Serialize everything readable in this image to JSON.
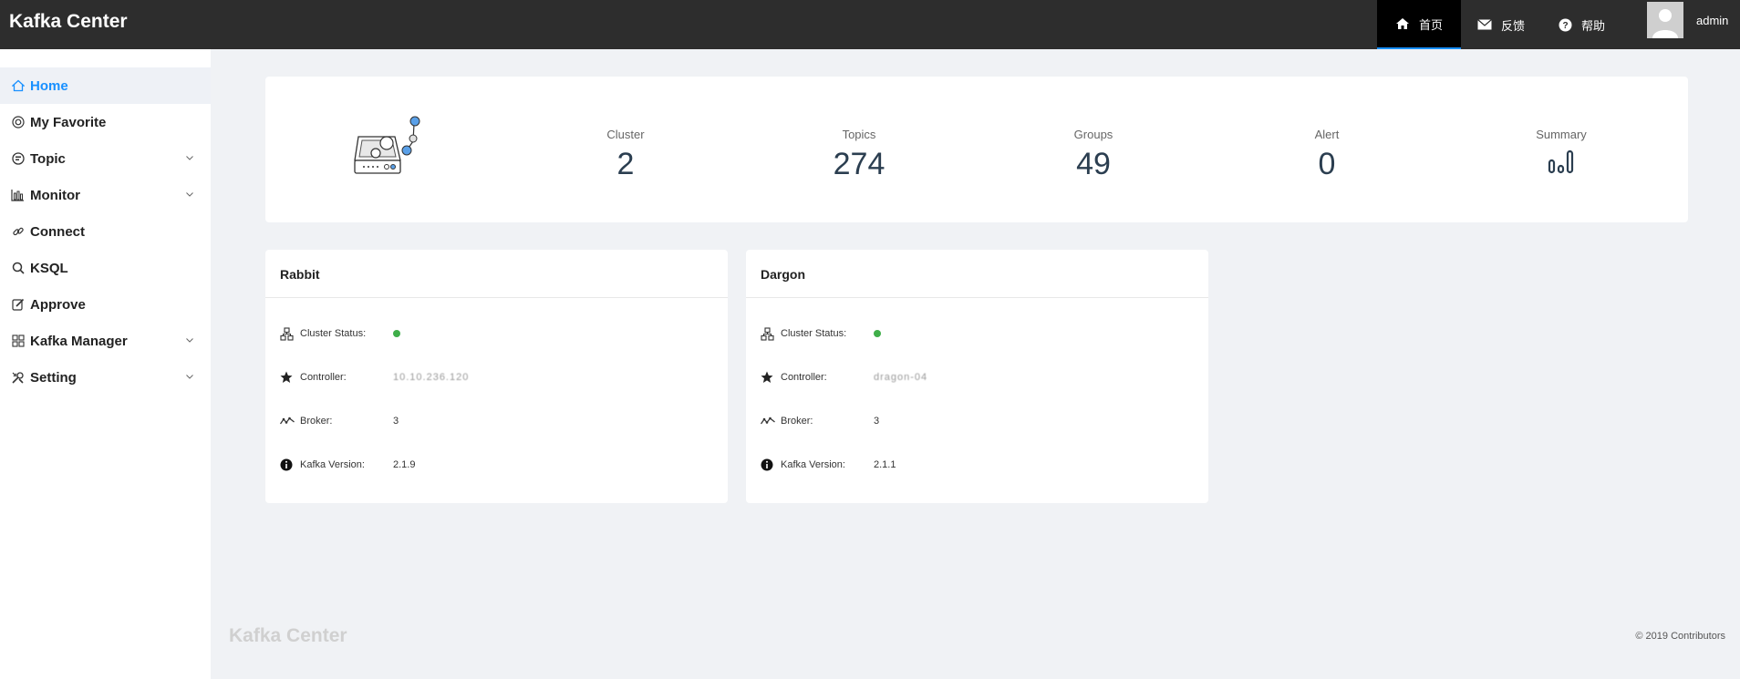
{
  "app": {
    "title": "Kafka Center"
  },
  "header": {
    "nav": [
      {
        "label": "首页",
        "icon": "home-icon",
        "active": true
      },
      {
        "label": "反馈",
        "icon": "mail-icon",
        "active": false
      },
      {
        "label": "帮助",
        "icon": "help-icon",
        "active": false
      }
    ],
    "user": {
      "name": "admin"
    }
  },
  "sidebar": {
    "items": [
      {
        "label": "Home",
        "icon": "home-icon",
        "active": true,
        "expandable": false
      },
      {
        "label": "My Favorite",
        "icon": "favorite-icon",
        "active": false,
        "expandable": false
      },
      {
        "label": "Topic",
        "icon": "topic-icon",
        "active": false,
        "expandable": true
      },
      {
        "label": "Monitor",
        "icon": "bar-chart-icon",
        "active": false,
        "expandable": true
      },
      {
        "label": "Connect",
        "icon": "link-icon",
        "active": false,
        "expandable": false
      },
      {
        "label": "KSQL",
        "icon": "search-icon",
        "active": false,
        "expandable": false
      },
      {
        "label": "Approve",
        "icon": "edit-icon",
        "active": false,
        "expandable": false
      },
      {
        "label": "Kafka Manager",
        "icon": "apps-icon",
        "active": false,
        "expandable": true
      },
      {
        "label": "Setting",
        "icon": "tools-icon",
        "active": false,
        "expandable": true
      }
    ]
  },
  "stats": {
    "cluster": {
      "label": "Cluster",
      "value": "2"
    },
    "topics": {
      "label": "Topics",
      "value": "274"
    },
    "groups": {
      "label": "Groups",
      "value": "49"
    },
    "alert": {
      "label": "Alert",
      "value": "0"
    },
    "summary": {
      "label": "Summary",
      "icon": "summary-chart-icon"
    }
  },
  "clusters": [
    {
      "name": "Rabbit",
      "status_label": "Cluster Status:",
      "status_color": "#3fae49",
      "controller_label": "Controller:",
      "controller_value": "10.10.236.120",
      "broker_label": "Broker:",
      "broker_value": "3",
      "version_label": "Kafka Version:",
      "version_value": "2.1.9"
    },
    {
      "name": "Dargon",
      "status_label": "Cluster Status:",
      "status_color": "#3fae49",
      "controller_label": "Controller:",
      "controller_value": "dragon-04",
      "broker_label": "Broker:",
      "broker_value": "3",
      "version_label": "Kafka Version:",
      "version_value": "2.1.1"
    }
  ],
  "footer": {
    "brand": "Kafka Center",
    "copyright": "© 2019 Contributors"
  },
  "colors": {
    "accent": "#1890ff",
    "header_bg": "#2d2d2d",
    "status_ok": "#3fae49"
  }
}
